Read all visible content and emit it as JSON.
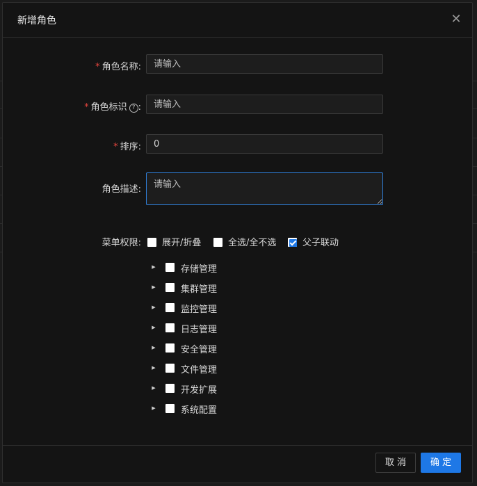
{
  "dialog": {
    "title": "新增角色",
    "close_icon": "close-icon"
  },
  "form": {
    "role_name": {
      "label": "角色名称:",
      "required": "*",
      "placeholder": "请输入",
      "value": ""
    },
    "role_key": {
      "label": "角色标识",
      "label_suffix": ":",
      "required": "*",
      "help_icon": "?",
      "placeholder": "请输入",
      "value": ""
    },
    "sort": {
      "label": "排序:",
      "required": "*",
      "placeholder": "",
      "value": "0"
    },
    "description": {
      "label": "角色描述:",
      "placeholder": "请输入",
      "value": ""
    },
    "menu_perm": {
      "label": "菜单权限:",
      "options": [
        {
          "label": "展开/折叠",
          "checked": false
        },
        {
          "label": "全选/全不选",
          "checked": false
        },
        {
          "label": "父子联动",
          "checked": true
        }
      ],
      "tree": [
        {
          "label": "存储管理",
          "checked": false
        },
        {
          "label": "集群管理",
          "checked": false
        },
        {
          "label": "监控管理",
          "checked": false
        },
        {
          "label": "日志管理",
          "checked": false
        },
        {
          "label": "安全管理",
          "checked": false
        },
        {
          "label": "文件管理",
          "checked": false
        },
        {
          "label": "开发扩展",
          "checked": false
        },
        {
          "label": "系统配置",
          "checked": false
        }
      ]
    }
  },
  "footer": {
    "cancel_label": "取 消",
    "ok_label": "确 定"
  },
  "colors": {
    "accent": "#1e78e6",
    "required": "#e5453d",
    "dialog_bg": "#141414"
  }
}
